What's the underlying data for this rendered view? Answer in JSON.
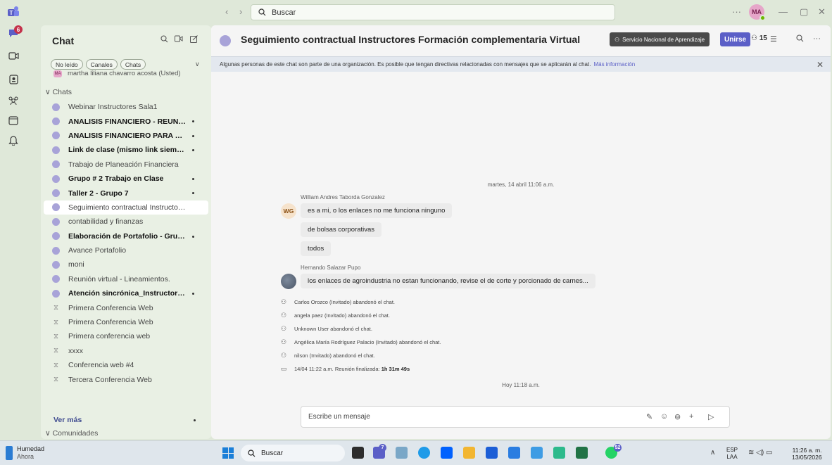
{
  "titlebar": {
    "search_placeholder": "Buscar",
    "more": "···",
    "avatar_initials": "MA",
    "minimize": "—",
    "maximize": "▢",
    "close": "✕"
  },
  "rail": {
    "activity_badge": "6"
  },
  "chat_panel": {
    "title": "Chat",
    "filters": [
      "No leído",
      "Canales",
      "Chats"
    ],
    "partial_row": "martha liliana chavarro acosta (Usted)",
    "section_chats": "∨ Chats",
    "items": [
      {
        "label": "Webinar Instructores Sala1",
        "unread": false,
        "kind": "chat"
      },
      {
        "label": "ANALISIS FINANCIERO - REUNIÓ...",
        "unread": true,
        "kind": "chat"
      },
      {
        "label": "ANALISIS FINANCIERO PARA TO...",
        "unread": true,
        "kind": "chat"
      },
      {
        "label": "Link de clase (mismo link siempre)",
        "unread": true,
        "kind": "chat"
      },
      {
        "label": "Trabajo de Planeación Financiera",
        "unread": false,
        "kind": "chat"
      },
      {
        "label": "Grupo # 2 Trabajo en Clase",
        "unread": true,
        "kind": "chat"
      },
      {
        "label": "Taller 2 - Grupo 7",
        "unread": true,
        "kind": "chat"
      },
      {
        "label": "Seguimiento contractual Instructore...",
        "unread": false,
        "kind": "chat",
        "selected": true
      },
      {
        "label": "contabilidad y finanzas",
        "unread": false,
        "kind": "chat"
      },
      {
        "label": "Elaboración de Portafolio - Grupo 5",
        "unread": true,
        "kind": "chat"
      },
      {
        "label": "Avance Portafolio",
        "unread": false,
        "kind": "chat"
      },
      {
        "label": "moni",
        "unread": false,
        "kind": "chat"
      },
      {
        "label": "Reunión virtual - Lineamientos.",
        "unread": false,
        "kind": "chat"
      },
      {
        "label": "Atención sincrónica_Instructores ...",
        "unread": true,
        "kind": "chat"
      },
      {
        "label": "Primera Conferencia Web",
        "unread": false,
        "kind": "meeting"
      },
      {
        "label": "Primera Conferencia Web",
        "unread": false,
        "kind": "meeting"
      },
      {
        "label": "Primera conferencia web",
        "unread": false,
        "kind": "meeting"
      },
      {
        "label": "xxxx",
        "unread": false,
        "kind": "meeting"
      },
      {
        "label": "Conferencia web #4",
        "unread": false,
        "kind": "meeting"
      },
      {
        "label": "Tercera Conferencia Web",
        "unread": false,
        "kind": "meeting"
      }
    ],
    "see_more": "Ver más",
    "section_communities": "∨ Comunidades"
  },
  "conversation": {
    "title": "Seguimiento contractual Instructores Formación complementaria Virtual",
    "org_button": "Servicio Nacional de Aprendizaje",
    "join_button": "Unirse",
    "participants_count": "15",
    "banner_text": "Algunas personas de este chat son parte de una organización. Es posible que tengan directivas relacionadas con mensajes que se aplicarán al chat.",
    "banner_link": "Más información",
    "date_separator_1": "martes, 14 abril 11:06 a.m.",
    "sender_1": "William Andres Taborda Gonzalez",
    "avatar_1": "WG",
    "messages_1": [
      "es a mi, o los enlaces no me funciona ninguno",
      "de bolsas corporativas",
      "todos"
    ],
    "sender_2": "Hernando Salazar Pupo",
    "messages_2": [
      "los enlaces de agroindustria no estan funcionando, revise el de corte y porcionado de carnes..."
    ],
    "system_events": [
      "Carlos Orozco (Invitado) abandonó el chat.",
      "angela paez (Invitado) abandonó el chat.",
      "Unknown User abandonó el chat.",
      "Angélica María Rodríguez Palacio (Invitado) abandonó el chat.",
      "nilson (Invitado) abandonó el chat."
    ],
    "meeting_end_prefix": "14/04 11:22 a.m.   Reunión finalizada: ",
    "meeting_end_duration": "1h 31m 49s",
    "date_separator_2": "Hoy 11:18 a.m.",
    "composer_placeholder": "Escribe un mensaje"
  },
  "taskbar": {
    "weather_title": "Humedad",
    "weather_sub": "Ahora",
    "search_label": "Buscar",
    "teams_badge": "7",
    "whatsapp_badge": "52",
    "lang_top": "ESP",
    "lang_bottom": "LAA",
    "time": "11:26 a. m.",
    "date": "13/05/2026"
  },
  "colors": {
    "accent": "#5b5fc7",
    "sidebar_bg": "#e9f0e4",
    "chrome_bg": "#dfe8d9",
    "badge_red": "#c4314b"
  }
}
